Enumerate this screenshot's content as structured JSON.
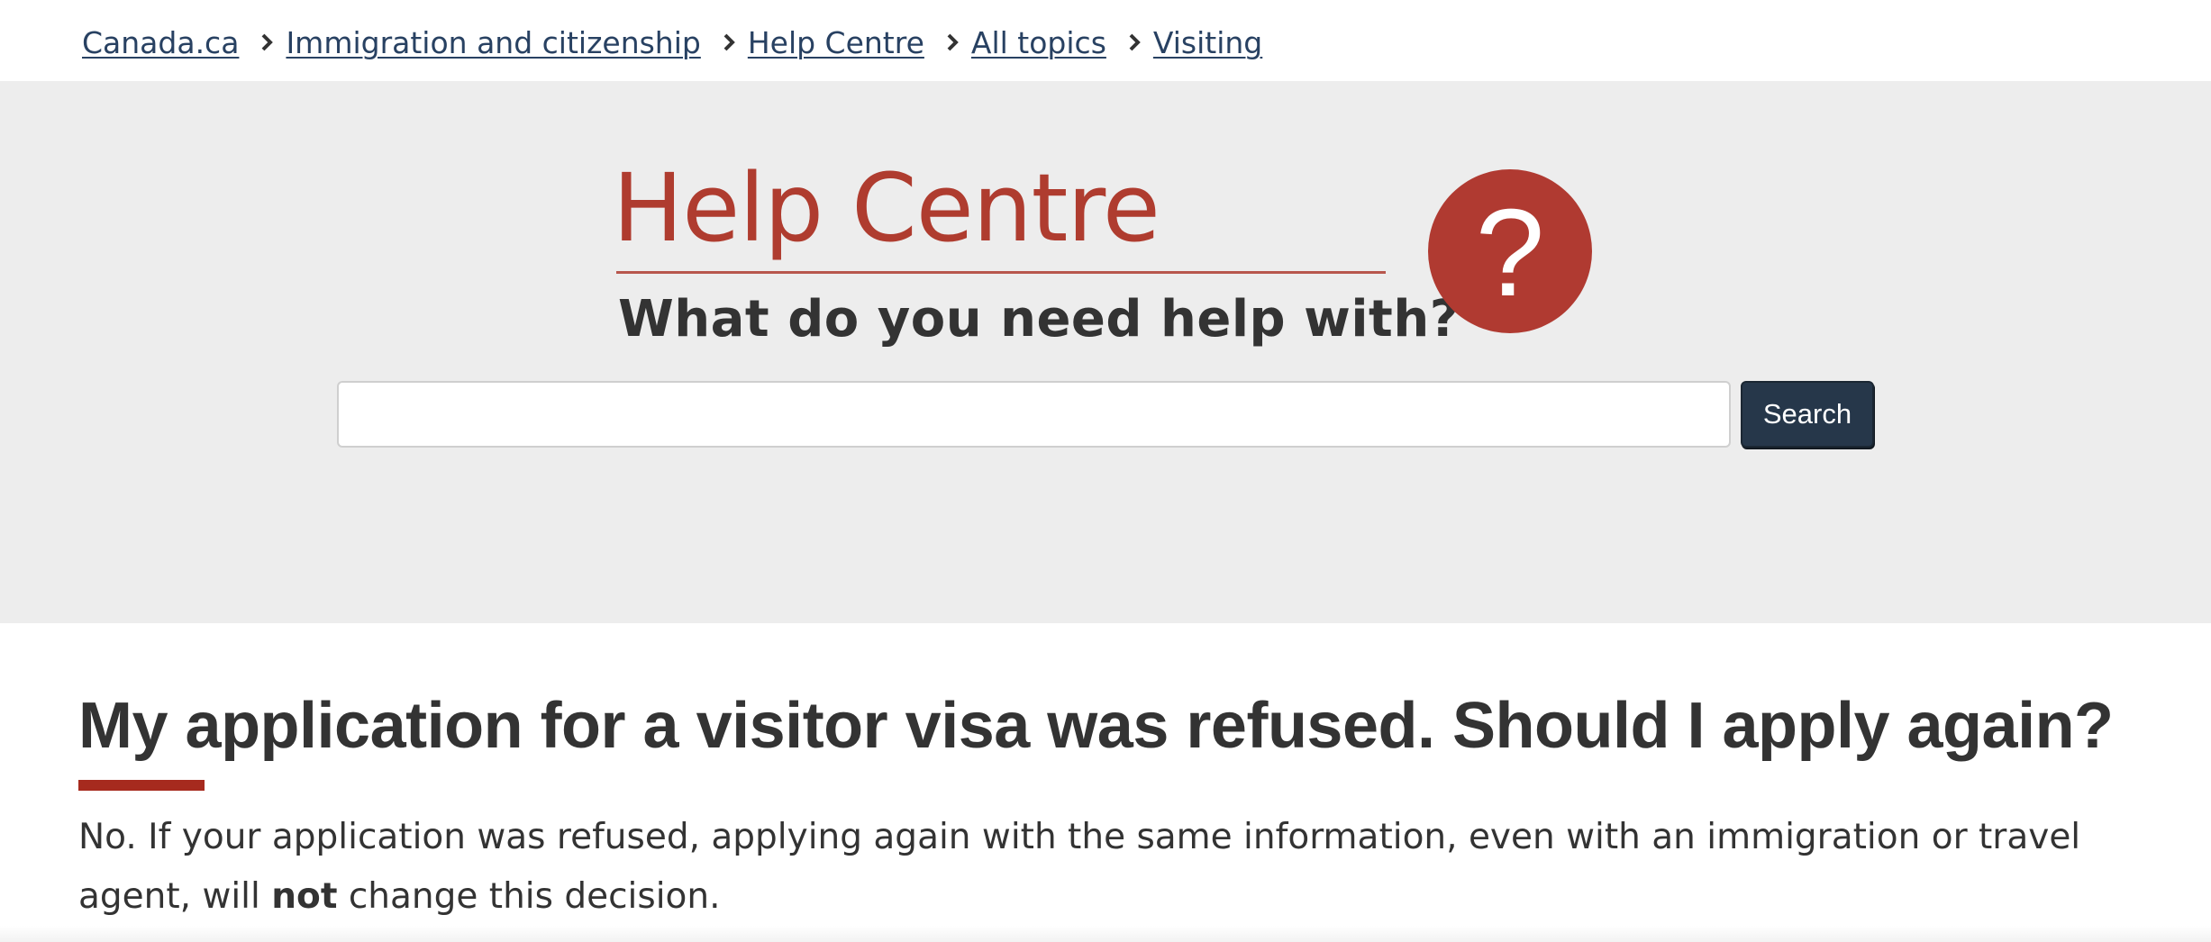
{
  "breadcrumb": {
    "items": [
      {
        "label": "Canada.ca"
      },
      {
        "label": "Immigration and citizenship"
      },
      {
        "label": "Help Centre"
      },
      {
        "label": "All topics"
      },
      {
        "label": "Visiting"
      }
    ]
  },
  "banner": {
    "title": "Help Centre",
    "subtitle": "What do you need help with?",
    "icon": "question-mark-icon",
    "icon_glyph": "?",
    "accent_color": "#af3c2f",
    "background_color": "#ededed",
    "search": {
      "placeholder": "",
      "value": "",
      "button_label": "Search",
      "button_color": "#26374a"
    }
  },
  "main": {
    "title": "My application for a visitor visa was refused. Should I apply again?",
    "paragraph": {
      "part1": "No. If your application was refused, applying again with the same information, even with an immigration or travel agent, will ",
      "emphasis": "not",
      "part2": " change this decision."
    }
  }
}
